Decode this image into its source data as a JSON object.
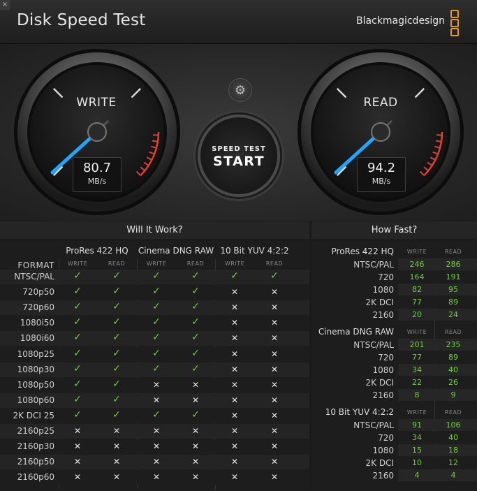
{
  "window": {
    "close": "×",
    "title": "Disk Speed Test",
    "brand": "Blackmagicdesign"
  },
  "gauges": {
    "write": {
      "label": "WRITE",
      "value": "80.7",
      "unit": "MB/s"
    },
    "read": {
      "label": "READ",
      "value": "94.2",
      "unit": "MB/s"
    },
    "settings_icon": "gear-icon",
    "start": {
      "line1": "SPEED TEST",
      "line2": "START"
    }
  },
  "will_it_work": {
    "title": "Will It Work?",
    "format_label": "FORMAT",
    "groups": [
      "ProRes 422 HQ",
      "Cinema DNG RAW",
      "10 Bit YUV 4:2:2"
    ],
    "sub": [
      "WRITE",
      "READ"
    ],
    "rows": [
      {
        "format": "NTSC/PAL",
        "cells": [
          1,
          1,
          1,
          1,
          1,
          1
        ]
      },
      {
        "format": "720p50",
        "cells": [
          1,
          1,
          1,
          1,
          0,
          0
        ]
      },
      {
        "format": "720p60",
        "cells": [
          1,
          1,
          1,
          1,
          0,
          0
        ]
      },
      {
        "format": "1080i50",
        "cells": [
          1,
          1,
          1,
          1,
          0,
          0
        ]
      },
      {
        "format": "1080i60",
        "cells": [
          1,
          1,
          1,
          1,
          0,
          0
        ]
      },
      {
        "format": "1080p25",
        "cells": [
          1,
          1,
          1,
          1,
          0,
          0
        ]
      },
      {
        "format": "1080p30",
        "cells": [
          1,
          1,
          1,
          1,
          0,
          0
        ]
      },
      {
        "format": "1080p50",
        "cells": [
          1,
          1,
          0,
          0,
          0,
          0
        ]
      },
      {
        "format": "1080p60",
        "cells": [
          1,
          1,
          0,
          0,
          0,
          0
        ]
      },
      {
        "format": "2K DCI 25",
        "cells": [
          1,
          1,
          1,
          1,
          0,
          0
        ]
      },
      {
        "format": "2160p25",
        "cells": [
          0,
          0,
          0,
          0,
          0,
          0
        ]
      },
      {
        "format": "2160p30",
        "cells": [
          0,
          0,
          0,
          0,
          0,
          0
        ]
      },
      {
        "format": "2160p50",
        "cells": [
          0,
          0,
          0,
          0,
          0,
          0
        ]
      },
      {
        "format": "2160p60",
        "cells": [
          0,
          0,
          0,
          0,
          0,
          0
        ]
      }
    ]
  },
  "how_fast": {
    "title": "How Fast?",
    "sub": [
      "WRITE",
      "READ"
    ],
    "groups": [
      {
        "name": "ProRes 422 HQ",
        "rows": [
          {
            "format": "NTSC/PAL",
            "write": "246",
            "read": "286"
          },
          {
            "format": "720",
            "write": "164",
            "read": "191"
          },
          {
            "format": "1080",
            "write": "82",
            "read": "95"
          },
          {
            "format": "2K DCI",
            "write": "77",
            "read": "89"
          },
          {
            "format": "2160",
            "write": "20",
            "read": "24"
          }
        ]
      },
      {
        "name": "Cinema DNG RAW",
        "rows": [
          {
            "format": "NTSC/PAL",
            "write": "201",
            "read": "235"
          },
          {
            "format": "720",
            "write": "77",
            "read": "89"
          },
          {
            "format": "1080",
            "write": "34",
            "read": "40"
          },
          {
            "format": "2K DCI",
            "write": "22",
            "read": "26"
          },
          {
            "format": "2160",
            "write": "8",
            "read": "9"
          }
        ]
      },
      {
        "name": "10 Bit YUV 4:2:2",
        "rows": [
          {
            "format": "NTSC/PAL",
            "write": "91",
            "read": "106"
          },
          {
            "format": "720",
            "write": "34",
            "read": "40"
          },
          {
            "format": "1080",
            "write": "15",
            "read": "18"
          },
          {
            "format": "2K DCI",
            "write": "10",
            "read": "12"
          },
          {
            "format": "2160",
            "write": "4",
            "read": "4"
          }
        ]
      }
    ]
  },
  "symbols": {
    "check": "✓",
    "cross": "✕"
  },
  "colors": {
    "check": "#6ed23a",
    "needle": "#1fa6ff",
    "redzone": "#e2402e",
    "accent": "#e39a2a"
  }
}
